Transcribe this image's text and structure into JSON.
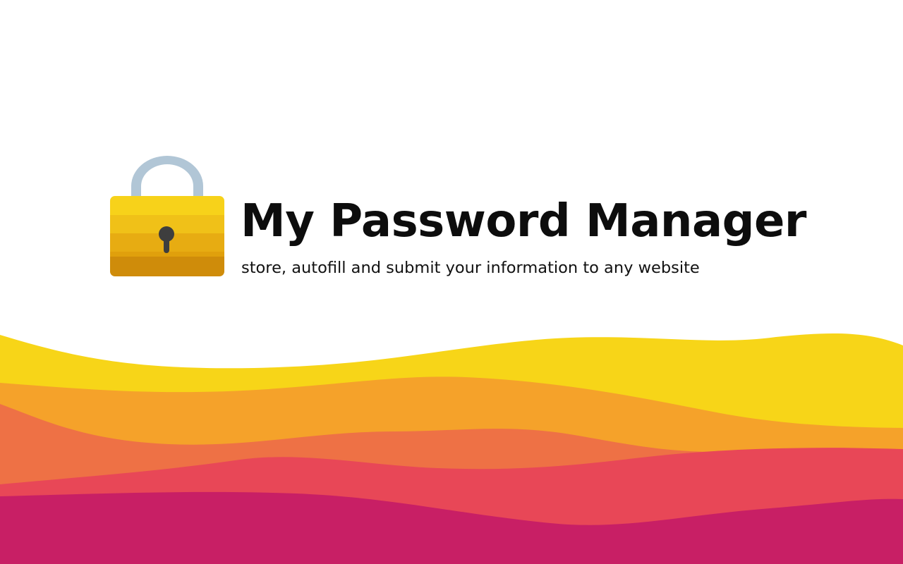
{
  "header": {
    "title": "My Password Manager",
    "subtitle": "store, autofill and submit your information to any website"
  },
  "logo": {
    "icon": "padlock-icon",
    "colors": {
      "shackle": "#b1c6d6",
      "body_bands": [
        "#f7d21a",
        "#f0c118",
        "#e7ac12",
        "#e0a00c",
        "#cf8c0a"
      ],
      "keyhole": "#3e3e3e"
    }
  },
  "background": {
    "wave_colors": [
      "#f7d518",
      "#f5a22a",
      "#ee7145",
      "#e84757",
      "#c81f65"
    ]
  }
}
